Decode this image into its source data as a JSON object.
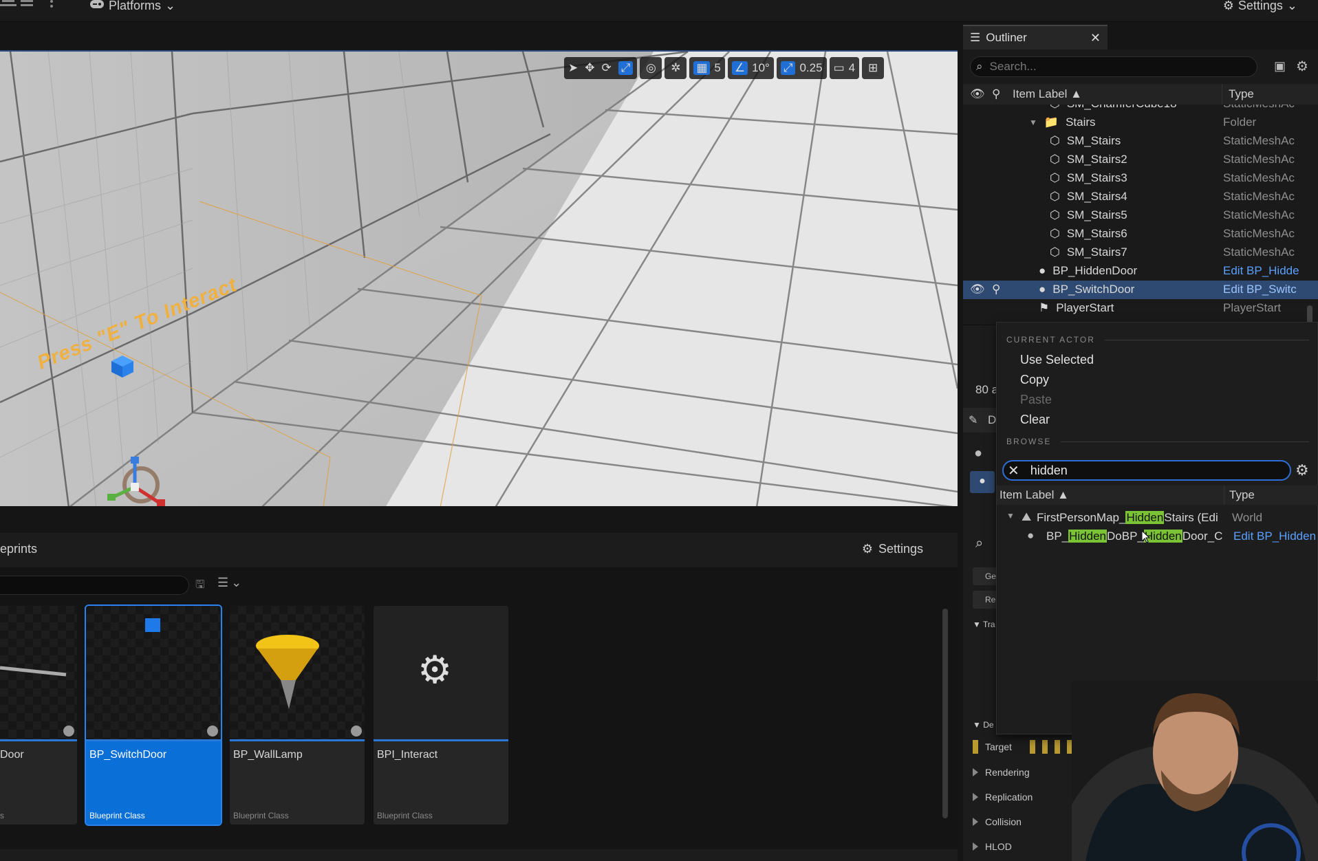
{
  "topbar": {
    "platforms_label": "Platforms",
    "settings_label": "Settings"
  },
  "viewport": {
    "grid_value": "5",
    "angle_value": "10°",
    "scale_value": "0.25",
    "camera_speed": "4",
    "world_text": "Press \"E\" To Interact"
  },
  "content_browser": {
    "title": "eprints",
    "settings_label": "Settings",
    "assets": [
      {
        "name": "Door",
        "class": "s"
      },
      {
        "name": "BP_SwitchDoor",
        "class": "Blueprint Class"
      },
      {
        "name": "BP_WallLamp",
        "class": "Blueprint Class"
      },
      {
        "name": "BPI_Interact",
        "class": "Blueprint Class"
      }
    ]
  },
  "outliner": {
    "tab_label": "Outliner",
    "search_placeholder": "Search...",
    "col_label": "Item Label",
    "col_type": "Type",
    "rows": [
      {
        "label": "SM_ChamferCube18",
        "type": "StaticMeshAc"
      },
      {
        "label": "Stairs",
        "type": "Folder"
      },
      {
        "label": "SM_Stairs",
        "type": "StaticMeshAc"
      },
      {
        "label": "SM_Stairs2",
        "type": "StaticMeshAc"
      },
      {
        "label": "SM_Stairs3",
        "type": "StaticMeshAc"
      },
      {
        "label": "SM_Stairs4",
        "type": "StaticMeshAc"
      },
      {
        "label": "SM_Stairs5",
        "type": "StaticMeshAc"
      },
      {
        "label": "SM_Stairs6",
        "type": "StaticMeshAc"
      },
      {
        "label": "SM_Stairs7",
        "type": "StaticMeshAc"
      },
      {
        "label": "BP_HiddenDoor",
        "type": "Edit BP_Hidde"
      },
      {
        "label": "BP_SwitchDoor",
        "type": "Edit BP_Switc"
      },
      {
        "label": "PlayerStart",
        "type": "PlayerStart"
      }
    ]
  },
  "details": {
    "partial_count": "80 a",
    "tab_partial": "D",
    "sections": [
      "Rendering",
      "Replication",
      "Collision",
      "HLOD"
    ],
    "target_label": "Target",
    "trans_partial": "Tra",
    "default_partial": "De",
    "btn_partial_1": "Ge",
    "btn_partial_2": "Re"
  },
  "popup": {
    "section_current": "CURRENT ACTOR",
    "use_selected": "Use Selected",
    "copy": "Copy",
    "paste": "Paste",
    "clear": "Clear",
    "section_browse": "BROWSE",
    "search_value": "hidden",
    "col_label": "Item Label",
    "col_type": "Type",
    "row1": {
      "pre": "FirstPersonMap_",
      "hl": "Hidden",
      "post": "Stairs (Edi",
      "type": "World"
    },
    "row2": {
      "pre": "BP_",
      "hl1": "Hidden",
      "mid": "DoBP_",
      "hl2": "Hidden",
      "post": "Door_C",
      "type": "Edit BP_Hidden"
    }
  }
}
